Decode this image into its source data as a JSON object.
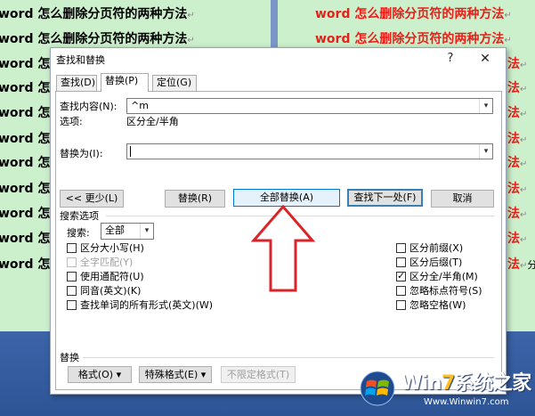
{
  "background_doc": {
    "left_lines": [
      "word 怎么删除分页符的两种方法",
      "word 怎么删除分页符的两种方法",
      "word 怎么",
      "word 怎么",
      "word 怎么",
      "word 怎么",
      "word 怎么",
      "word 怎么",
      "word 怎么",
      "word 怎么",
      "word 怎么"
    ],
    "right_lines": [
      "word 怎么删除分页符的两种方法",
      "word 怎么删除分页符的两种方法",
      "法",
      "法",
      "法",
      "法",
      "法",
      "法",
      "法",
      "法",
      "法"
    ],
    "paragraph_mark": "↵",
    "right_extra": "分",
    "colors": {
      "page": "#ccefcc",
      "right_text": "#e8201a"
    }
  },
  "dialog": {
    "title": "查找和替换",
    "help": "?",
    "close": "✕",
    "tabs": [
      {
        "label": "查找(D)",
        "active": false
      },
      {
        "label": "替换(P)",
        "active": true
      },
      {
        "label": "定位(G)",
        "active": false
      }
    ],
    "find": {
      "label": "查找内容(N):",
      "value": "^m",
      "options_label": "选项:",
      "options_value": "区分全/半角"
    },
    "replace": {
      "label": "替换为(I):",
      "value": ""
    },
    "buttons": {
      "less": "<< 更少(L)",
      "replace": "替换(R)",
      "replace_all": "全部替换(A)",
      "find_next": "查找下一处(F)",
      "cancel": "取消"
    },
    "search_options": {
      "heading": "搜索选项",
      "search_label": "搜索:",
      "search_value": "全部"
    },
    "checkboxes_left": [
      {
        "label": "区分大小写(H)",
        "checked": false,
        "disabled": false
      },
      {
        "label": "全字匹配(Y)",
        "checked": false,
        "disabled": true
      },
      {
        "label": "使用通配符(U)",
        "checked": false,
        "disabled": false
      },
      {
        "label": "同音(英文)(K)",
        "checked": false,
        "disabled": false
      },
      {
        "label": "查找单词的所有形式(英文)(W)",
        "checked": false,
        "disabled": false
      }
    ],
    "checkboxes_right": [
      {
        "label": "区分前缀(X)",
        "checked": false,
        "disabled": false
      },
      {
        "label": "区分后缀(T)",
        "checked": false,
        "disabled": false
      },
      {
        "label": "区分全/半角(M)",
        "checked": true,
        "disabled": false
      },
      {
        "label": "忽略标点符号(S)",
        "checked": false,
        "disabled": false
      },
      {
        "label": "忽略空格(W)",
        "checked": false,
        "disabled": false
      }
    ],
    "replace_section": {
      "heading": "替换",
      "format": "格式(O) ▾",
      "special": "特殊格式(E) ▾",
      "no_format": "不限定格式(T)"
    }
  },
  "watermark": {
    "title_a": "Win",
    "title_seven": "7",
    "title_b": "系统之家",
    "url": "Www.Winwin7.com"
  },
  "colors": {
    "arrow": "#d9252a",
    "accent": "#0078d7",
    "desktop": "#4a6fae"
  }
}
